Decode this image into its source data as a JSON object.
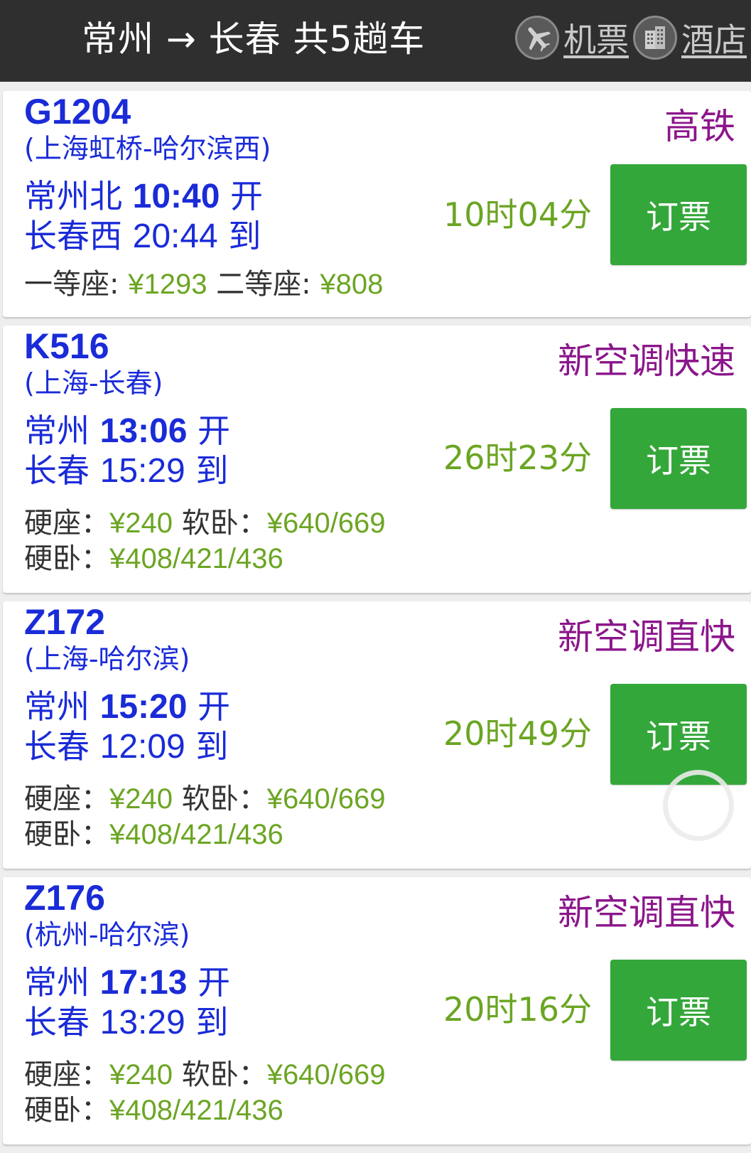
{
  "header": {
    "title": "常州 → 长春 共5趟车",
    "flight_link": "机票",
    "hotel_link": "酒店",
    "flight_icon": "airplane-icon",
    "hotel_icon": "building-icon"
  },
  "trains": [
    {
      "number": "G1204",
      "route": "(上海虹桥-哈尔滨西)",
      "type": "高铁",
      "dep_station": "常州北",
      "dep_time": "10:40",
      "dep_suffix": "开",
      "arr_station": "长春西",
      "arr_time": "20:44",
      "arr_suffix": "到",
      "duration": "10时04分",
      "book_label": "订票",
      "prices": [
        {
          "label": "一等座: ",
          "value": "¥1293"
        },
        {
          "label": "二等座: ",
          "value": "¥808"
        }
      ]
    },
    {
      "number": "K516",
      "route": "(上海-长春)",
      "type": "新空调快速",
      "dep_station": "常州",
      "dep_time": "13:06",
      "dep_suffix": "开",
      "arr_station": "长春",
      "arr_time": "15:29",
      "arr_suffix": "到",
      "duration": "26时23分",
      "book_label": "订票",
      "prices": [
        {
          "label": "硬座：",
          "value": "¥240"
        },
        {
          "label": "软卧：",
          "value": "¥640/669"
        },
        {
          "label": "硬卧：",
          "value": "¥408/421/436"
        }
      ]
    },
    {
      "number": "Z172",
      "route": "(上海-哈尔滨)",
      "type": "新空调直快",
      "dep_station": "常州",
      "dep_time": "15:20",
      "dep_suffix": "开",
      "arr_station": "长春",
      "arr_time": "12:09",
      "arr_suffix": "到",
      "duration": "20时49分",
      "book_label": "订票",
      "prices": [
        {
          "label": "硬座：",
          "value": "¥240"
        },
        {
          "label": "软卧：",
          "value": "¥640/669"
        },
        {
          "label": "硬卧：",
          "value": "¥408/421/436"
        }
      ]
    },
    {
      "number": "Z176",
      "route": "(杭州-哈尔滨)",
      "type": "新空调直快",
      "dep_station": "常州",
      "dep_time": "17:13",
      "dep_suffix": "开",
      "arr_station": "长春",
      "arr_time": "13:29",
      "arr_suffix": "到",
      "duration": "20时16分",
      "book_label": "订票",
      "prices": [
        {
          "label": "硬座：",
          "value": "¥240"
        },
        {
          "label": "软卧：",
          "value": "¥640/669"
        },
        {
          "label": "硬卧：",
          "value": "¥408/421/436"
        }
      ]
    }
  ],
  "colors": {
    "header_bg": "#2f2f2f",
    "train_blue": "#1a2bd8",
    "type_purple": "#8b168b",
    "price_green": "#6ba523",
    "button_green": "#34a73a"
  }
}
